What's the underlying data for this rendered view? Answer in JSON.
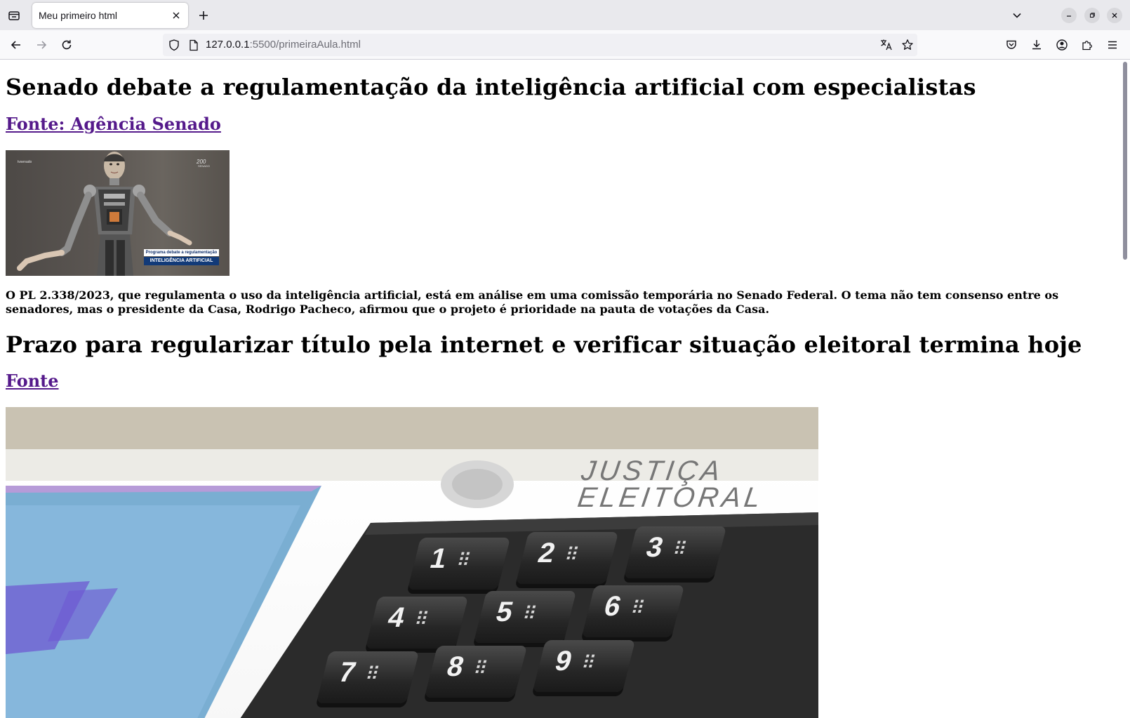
{
  "browser": {
    "tab_title": "Meu primeiro html",
    "url_host": "127.0.0.1",
    "url_rest": ":5500/primeiraAula.html"
  },
  "articles": [
    {
      "title": "Senado debate a regulamentação da inteligência artificial com especialistas",
      "source_link": "Fonte: Agência Senado",
      "image": {
        "caption_line1": "Programa debate a regulamentação",
        "caption_line2": "INTELIGÊNCIA ARTIFICIAL"
      },
      "body": "O PL 2.338/2023, que regulamenta o uso da inteligência artificial, está em análise em uma comissão temporária no Senado Federal. O tema não tem consenso entre os senadores, mas o presidente da Casa, Rodrigo Pacheco, afirmou que o projeto é prioridade na pauta de votações da Casa."
    },
    {
      "title": "Prazo para regularizar título pela internet e verificar situação eleitoral termina hoje",
      "source_link": "Fonte",
      "image": {
        "label_line1": "JUSTIÇA",
        "label_line2": "ELEITORAL",
        "keys": [
          "1",
          "2",
          "3",
          "4",
          "5",
          "6",
          "7",
          "8",
          "9"
        ]
      }
    }
  ]
}
